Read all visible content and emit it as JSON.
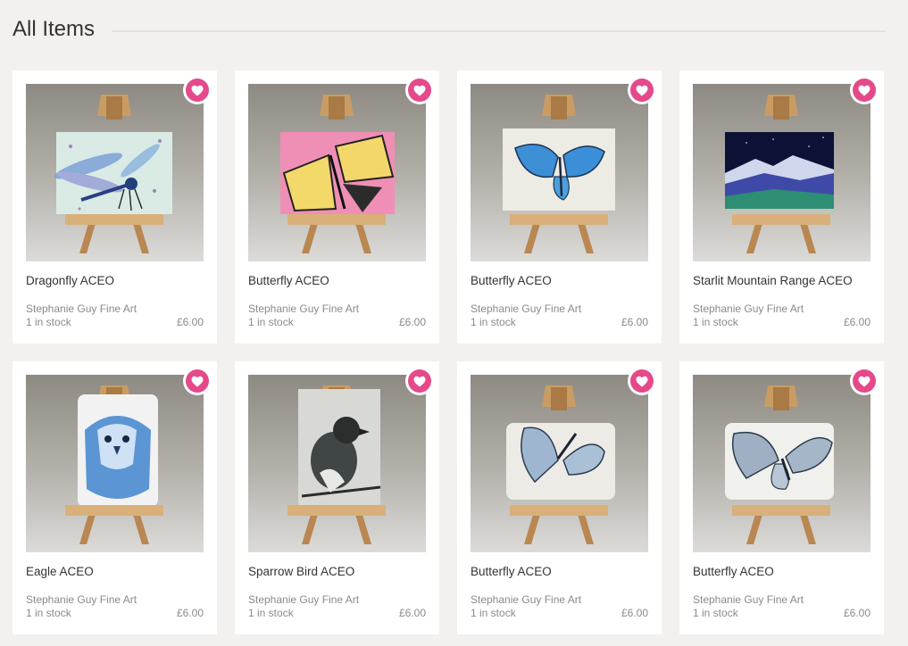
{
  "section": {
    "title": "All Items"
  },
  "colors": {
    "accent": "#e5498a",
    "background": "#f2f1ef",
    "card": "#ffffff"
  },
  "items": [
    {
      "title": "Dragonfly ACEO",
      "seller": "Stephanie Guy Fine Art",
      "stock": "1 in stock",
      "price": "£6.00",
      "art": "dragonfly",
      "favorite_icon": "heart-icon"
    },
    {
      "title": "Butterfly ACEO",
      "seller": "Stephanie Guy Fine Art",
      "stock": "1 in stock",
      "price": "£6.00",
      "art": "yellow-butterfly",
      "favorite_icon": "heart-icon"
    },
    {
      "title": "Butterfly ACEO",
      "seller": "Stephanie Guy Fine Art",
      "stock": "1 in stock",
      "price": "£6.00",
      "art": "blue-butterfly",
      "favorite_icon": "heart-icon"
    },
    {
      "title": "Starlit Mountain Range ACEO",
      "seller": "Stephanie Guy Fine Art",
      "stock": "1 in stock",
      "price": "£6.00",
      "art": "mountains",
      "favorite_icon": "heart-icon"
    },
    {
      "title": "Eagle ACEO",
      "seller": "Stephanie Guy Fine Art",
      "stock": "1 in stock",
      "price": "£6.00",
      "art": "eagle",
      "favorite_icon": "heart-icon"
    },
    {
      "title": "Sparrow Bird ACEO",
      "seller": "Stephanie Guy Fine Art",
      "stock": "1 in stock",
      "price": "£6.00",
      "art": "sparrow",
      "favorite_icon": "heart-icon"
    },
    {
      "title": "Butterfly ACEO",
      "seller": "Stephanie Guy Fine Art",
      "stock": "1 in stock",
      "price": "£6.00",
      "art": "moth-blue",
      "favorite_icon": "heart-icon"
    },
    {
      "title": "Butterfly ACEO",
      "seller": "Stephanie Guy Fine Art",
      "stock": "1 in stock",
      "price": "£6.00",
      "art": "moth-grey",
      "favorite_icon": "heart-icon"
    }
  ]
}
